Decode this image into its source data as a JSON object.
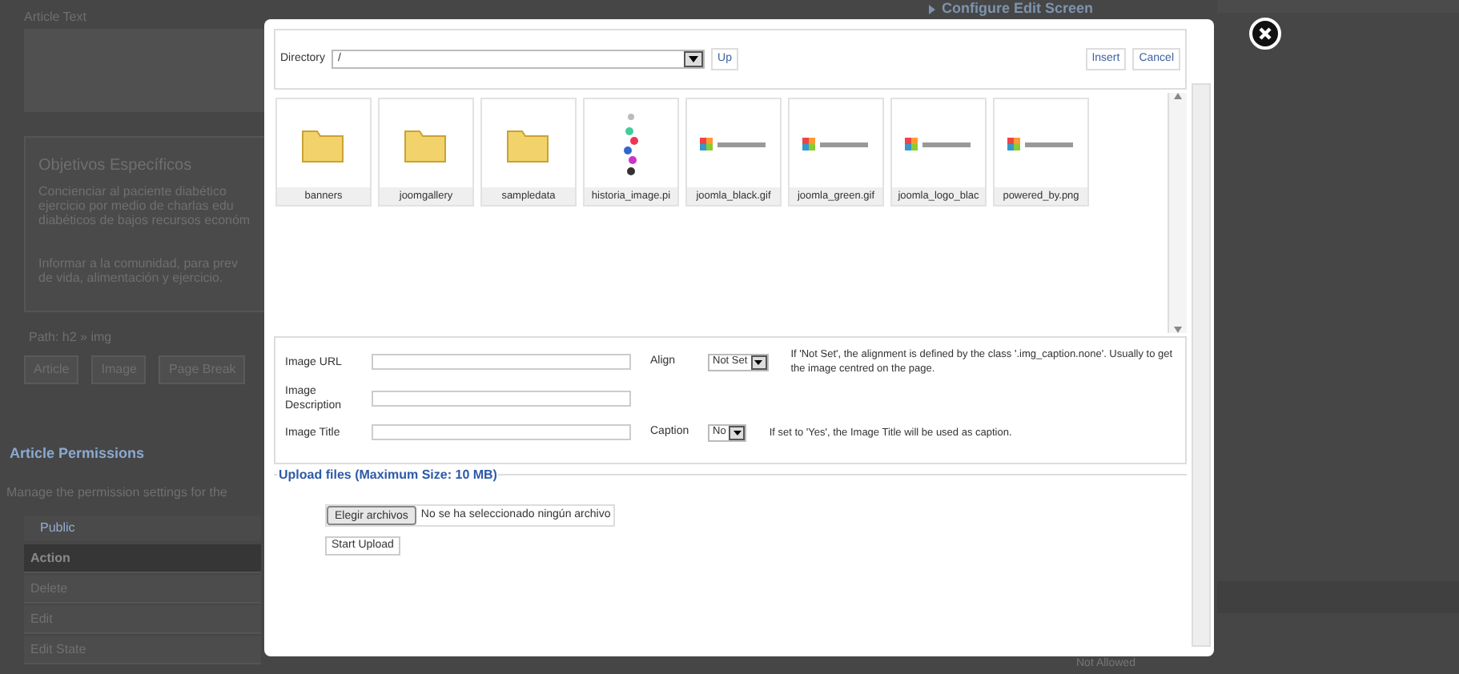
{
  "background": {
    "editor_label": "Article Text",
    "heading": "Objetivos Específicos",
    "paragraphs": [
      "Concienciar al paciente diabético",
      "ejercicio por medio de charlas edu",
      "diabéticos de bajos recursos económ",
      "Informar a la comunidad, para prev",
      "de vida, alimentación y ejercicio."
    ],
    "path": "Path: h2 » img",
    "editor_buttons": [
      "Article",
      "Image",
      "Page Break"
    ],
    "section_title": "Article Permissions",
    "description": "Manage the permission settings for the",
    "group": "Public",
    "rows": [
      {
        "label": "Action",
        "header": true
      },
      {
        "label": "Delete",
        "header": false
      },
      {
        "label": "Edit",
        "header": false
      },
      {
        "label": "Edit State",
        "header": false
      }
    ],
    "right_title": "Configure Edit Screen",
    "right_status": "Not Allowed"
  },
  "dialog": {
    "directory_label": "Directory",
    "directory_value": "/",
    "up_button": "Up",
    "insert_button": "Insert",
    "cancel_button": "Cancel",
    "files": [
      {
        "name": "banners",
        "kind": "folder"
      },
      {
        "name": "joomgallery",
        "kind": "folder"
      },
      {
        "name": "sampledata",
        "kind": "folder"
      },
      {
        "name": "historia_image.pi",
        "kind": "beads"
      },
      {
        "name": "joomla_black.gif",
        "kind": "logo"
      },
      {
        "name": "joomla_green.gif",
        "kind": "logo"
      },
      {
        "name": "joomla_logo_blac",
        "kind": "logo"
      },
      {
        "name": "powered_by.png",
        "kind": "logo"
      }
    ],
    "fields": [
      {
        "label": "Image URL",
        "option_label": "Align",
        "option_value": "Not Set",
        "hint": "If 'Not Set', the alignment is defined by the class '.img_caption.none'. Usually to get the image centred on the page."
      },
      {
        "label": "Image Description"
      },
      {
        "label": "Image Title",
        "option_label": "Caption",
        "option_value": "No",
        "hint": "If set to 'Yes', the Image Title will be used as caption."
      }
    ],
    "upload_legend": "Upload files (Maximum Size: 10 MB)",
    "choose_button": "Elegir archivos",
    "no_file": "No se ha seleccionado ningún archivo",
    "start_button": "Start Upload"
  }
}
